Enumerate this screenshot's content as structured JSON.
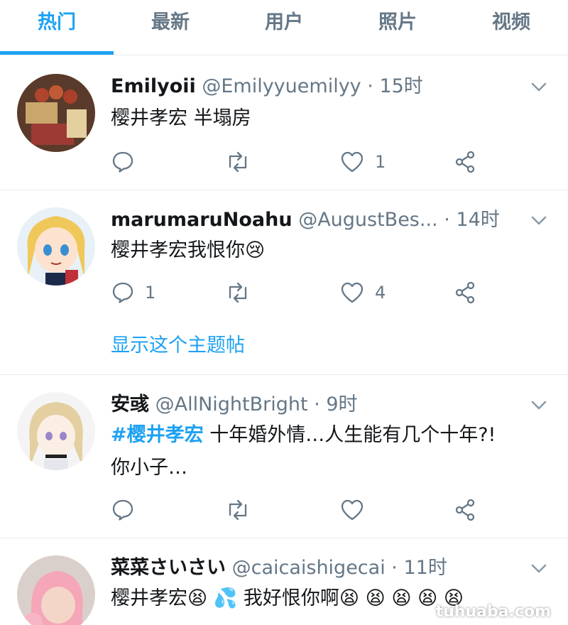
{
  "tabs": [
    {
      "label": "热门",
      "active": true
    },
    {
      "label": "最新",
      "active": false
    },
    {
      "label": "用户",
      "active": false
    },
    {
      "label": "照片",
      "active": false
    },
    {
      "label": "视频",
      "active": false
    }
  ],
  "colors": {
    "accent": "#1da1f2",
    "secondary_text": "#657786",
    "divider": "#e6ecf0"
  },
  "tweets": [
    {
      "name": "Emilyoii",
      "handle": "@Emilyyuemilyy",
      "time": "15时",
      "text": "樱井孝宏 半塌房",
      "reply_count": "",
      "retweet_count": "",
      "like_count": "1"
    },
    {
      "name": "marumaruNoahu",
      "handle": "@AugustBes...",
      "time": "14时",
      "text": "樱井孝宏我恨你😢",
      "reply_count": "1",
      "retweet_count": "",
      "like_count": "4",
      "show_thread": "显示这个主题帖"
    },
    {
      "name": "安彧",
      "handle": "@AllNightBright",
      "time": "9时",
      "hashtag": "#樱井孝宏",
      "text": " 十年婚外情…人生能有几个十年?!",
      "text_line2": "你小子…",
      "reply_count": "",
      "retweet_count": "",
      "like_count": ""
    },
    {
      "name": "菜菜さいさい",
      "handle": "@caicaishigecai",
      "time": "11时",
      "text": "樱井孝宏😫 💦 我好恨你啊😫 😫 😫 😫 😫"
    }
  ],
  "separator": "·",
  "watermark": "tuhuaba.com"
}
